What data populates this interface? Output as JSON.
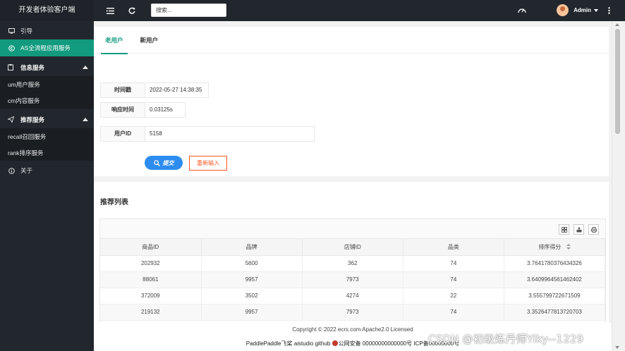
{
  "app": {
    "title": "开发者体验客户端"
  },
  "sidebar": {
    "items": [
      {
        "label": "引导",
        "icon": "monitor-icon"
      },
      {
        "label": "AS全流程应用服务",
        "icon": "copyright-icon",
        "active": true
      }
    ],
    "groups": [
      {
        "label": "信息服务",
        "icon": "clipboard-icon",
        "children": [
          "um用户服务",
          "cm内容服务"
        ]
      },
      {
        "label": "推荐服务",
        "icon": "paper-plane-icon",
        "children": [
          "recall召回服务",
          "rank排序服务"
        ]
      }
    ],
    "about": {
      "label": "关于",
      "icon": "info-icon"
    }
  },
  "topbar": {
    "search_placeholder": "搜索...",
    "user_name": "Admin"
  },
  "tabs": [
    "老用户",
    "新用户"
  ],
  "form": {
    "timestamp_label": "时间戳",
    "timestamp_value": "2022-05-27 14:38:35",
    "response_label": "响应时间",
    "response_value": "0.03125s",
    "userid_label": "用户ID",
    "userid_value": "5158",
    "submit_label": "提交",
    "reset_label": "重新输入"
  },
  "table": {
    "title": "推荐列表",
    "columns": [
      "商品ID",
      "品牌",
      "店铺ID",
      "品类",
      "排序得分"
    ],
    "rows": [
      [
        "202932",
        "5600",
        "362",
        "74",
        "3.7641780376434326"
      ],
      [
        "88061",
        "9957",
        "7973",
        "74",
        "3.6409964561462402"
      ],
      [
        "372009",
        "3502",
        "4274",
        "22",
        "3.555799722671509"
      ],
      [
        "219132",
        "9957",
        "7973",
        "74",
        "3.3526477813720703"
      ]
    ]
  },
  "footer": {
    "line1": "Copyright © 2022   ecrs.com  Apache2.0 Licensed",
    "line2_a": "PaddlePaddle飞桨 aistudio github ",
    "line2_b": "公网安备 00000000000000号 ICP备00000000号"
  },
  "watermark": "CSDN @初级炼丹师Yiky--1229",
  "colors": {
    "accent": "#129a7e",
    "primary": "#2d8cf0",
    "danger": "#ff5722",
    "sidebar": "#22272e"
  }
}
